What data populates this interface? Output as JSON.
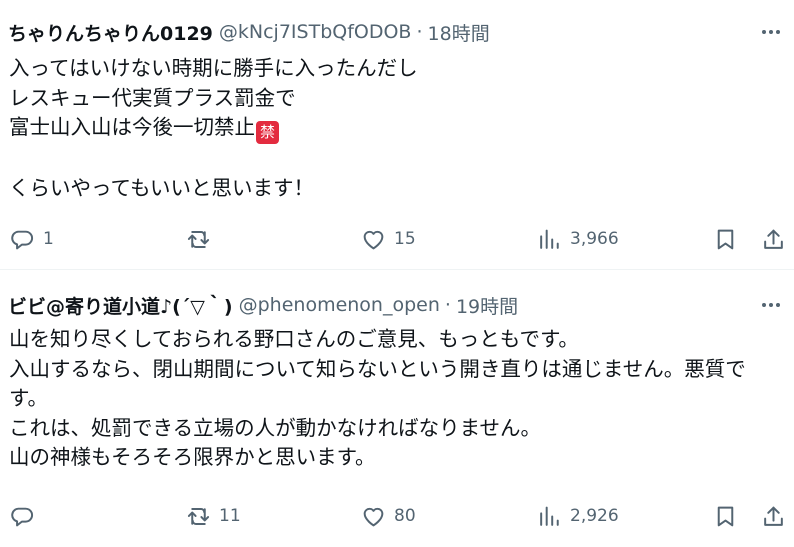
{
  "tweets": [
    {
      "name": "ちゃりんちゃりん0129",
      "handle": "@kNcj7ISTbQfODOB",
      "separator": "·",
      "time": "18時間",
      "lines": [
        "入ってはいけない時期に勝手に入ったんだし",
        "レスキュー代実質プラス罰金で",
        "富士山入山は今後一切禁止",
        "",
        "くらいやってもいいと思います！"
      ],
      "emoji": "禁",
      "replies": "1",
      "retweets": "",
      "likes": "15",
      "views": "3,966"
    },
    {
      "name": "ビビ@寄り道小道♪(´▽｀)",
      "handle": "@phenomenon_open",
      "separator": "·",
      "time": "19時間",
      "lines": [
        "山を知り尽くしておられる野口さんのご意見、もっともです。",
        "入山するなら、閉山期間について知らないという開き直りは通じません。悪質です。",
        "これは、処罰できる立場の人が動かなければなりません。",
        "山の神様もそろそろ限界かと思います。"
      ],
      "replies": "",
      "retweets": "11",
      "likes": "80",
      "views": "2,926"
    }
  ],
  "icons": {
    "more": "more-horizontal-icon",
    "reply": "reply-icon",
    "retweet": "retweet-icon",
    "like": "heart-icon",
    "views": "views-chart-icon",
    "bookmark": "bookmark-icon",
    "share": "share-icon"
  },
  "colors": {
    "text": "#0f1419",
    "secondary": "#536471",
    "divider": "#eff3f4",
    "ban_emoji": "#e32b3f"
  }
}
